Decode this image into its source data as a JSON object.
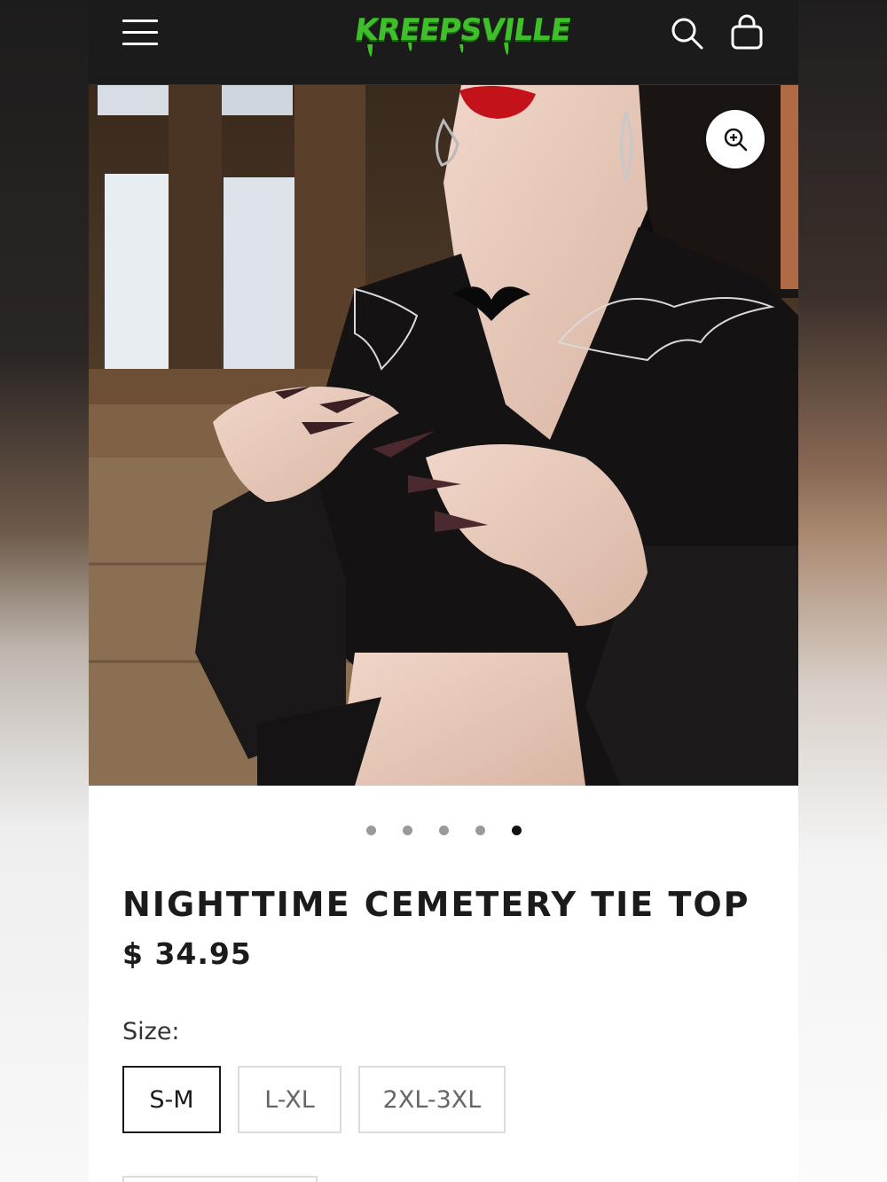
{
  "header": {
    "logo_text": "KREEPSVILLE",
    "menu_icon": "hamburger-menu-icon",
    "search_icon": "search-icon",
    "cart_icon": "shopping-bag-icon",
    "logo_color": "#3fbf2a"
  },
  "gallery": {
    "zoom_icon": "zoom-in-icon",
    "slide_count": 5,
    "active_slide": 5
  },
  "product": {
    "title": "NIGHTTIME CEMETERY TIE TOP",
    "price": "$ 34.95",
    "size_label": "Size:",
    "sizes": [
      {
        "label": "S-M",
        "selected": true
      },
      {
        "label": "L-XL",
        "selected": false
      },
      {
        "label": "2XL-3XL",
        "selected": false
      }
    ]
  }
}
